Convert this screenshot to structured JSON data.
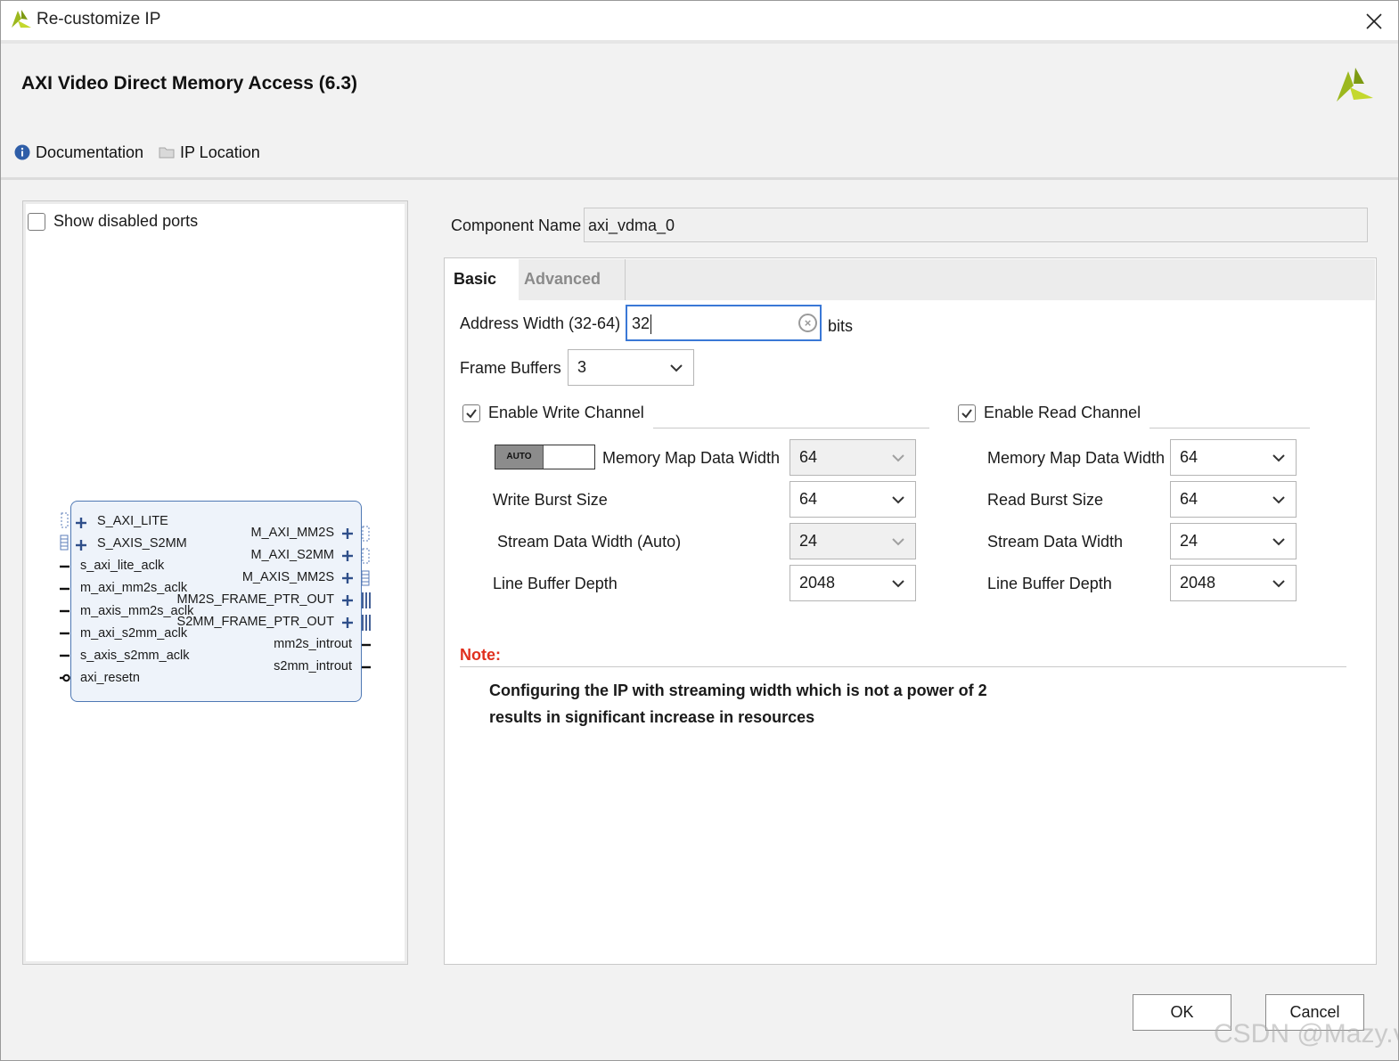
{
  "window": {
    "title": "Re-customize IP",
    "close_icon": "close-icon"
  },
  "header": {
    "ip_title": "AXI Video Direct Memory Access (6.3)",
    "documentation": "Documentation",
    "ip_location": "IP Location"
  },
  "left_panel": {
    "show_disabled_ports": "Show disabled ports",
    "show_disabled_ports_checked": false,
    "ports_left": [
      "S_AXI_LITE",
      "S_AXIS_S2MM",
      "s_axi_lite_aclk",
      "m_axi_mm2s_aclk",
      "m_axis_mm2s_aclk",
      "m_axi_s2mm_aclk",
      "s_axis_s2mm_aclk",
      "axi_resetn"
    ],
    "ports_right": [
      "M_AXI_MM2S",
      "M_AXI_S2MM",
      "M_AXIS_MM2S",
      "MM2S_FRAME_PTR_OUT",
      "S2MM_FRAME_PTR_OUT",
      "mm2s_introut",
      "s2mm_introut"
    ]
  },
  "component": {
    "label": "Component Name",
    "value": "axi_vdma_0"
  },
  "tabs": {
    "basic": "Basic",
    "advanced": "Advanced"
  },
  "basic": {
    "address_width_label": "Address Width (32-64)",
    "address_width_value": "32",
    "address_width_unit": "bits",
    "frame_buffers_label": "Frame Buffers",
    "frame_buffers_value": "3",
    "write": {
      "enable_label": "Enable Write Channel",
      "enabled": true,
      "auto_label": "AUTO",
      "mm_data_width_label": "Memory Map Data Width",
      "mm_data_width_value": "64",
      "burst_size_label": "Write Burst Size",
      "burst_size_value": "64",
      "stream_width_label": "Stream Data Width (Auto)",
      "stream_width_value": "24",
      "line_buffer_label": "Line Buffer Depth",
      "line_buffer_value": "2048"
    },
    "read": {
      "enable_label": "Enable Read Channel",
      "enabled": true,
      "mm_data_width_label": "Memory Map Data Width",
      "mm_data_width_value": "64",
      "burst_size_label": "Read Burst Size",
      "burst_size_value": "64",
      "stream_width_label": "Stream Data Width",
      "stream_width_value": "24",
      "line_buffer_label": "Line Buffer Depth",
      "line_buffer_value": "2048"
    },
    "note_label": "Note:",
    "note_line1": "Configuring the IP with streaming width which is not a power of 2",
    "note_line2": "results in significant increase in resources"
  },
  "buttons": {
    "ok": "OK",
    "cancel": "Cancel"
  },
  "watermark": "CSDN @Mazy.v",
  "colors": {
    "accent": "#3a78d6",
    "note": "#e0301e",
    "logo": "#9cb81e",
    "block_border": "#4e78b4"
  }
}
